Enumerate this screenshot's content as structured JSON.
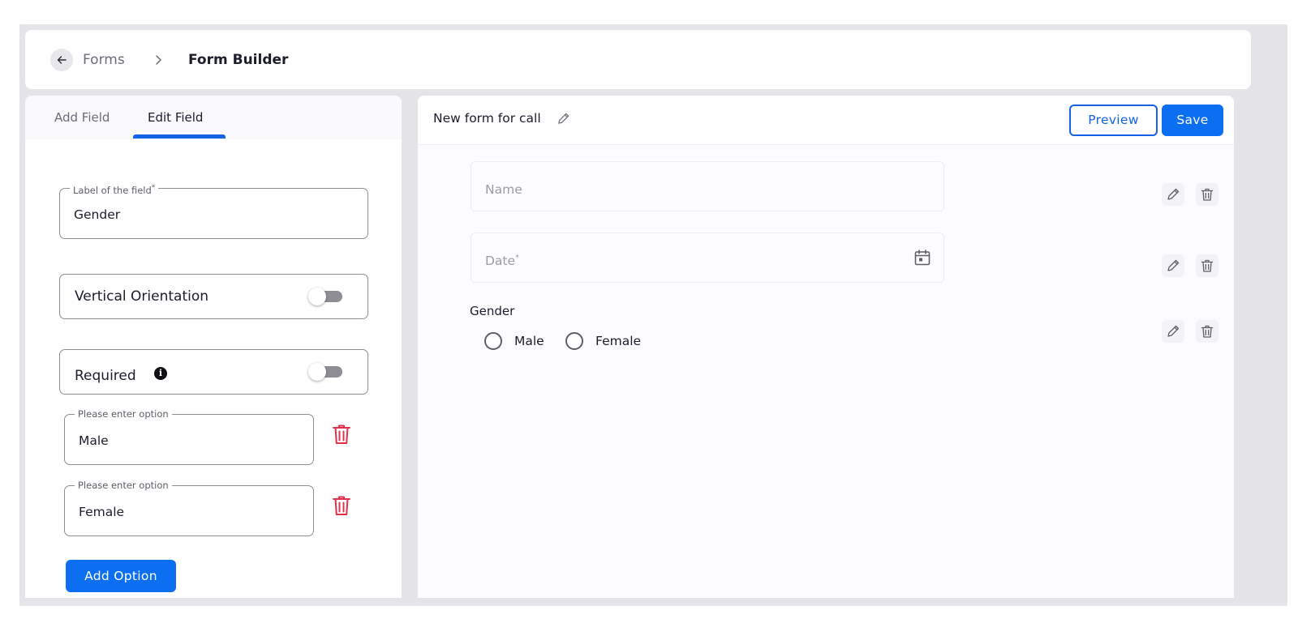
{
  "header": {
    "breadcrumb_parent": "Forms",
    "breadcrumb_current": "Form Builder"
  },
  "left_panel": {
    "tabs": [
      {
        "label": "Add Field",
        "active": false
      },
      {
        "label": "Edit Field",
        "active": true
      }
    ],
    "label_field": {
      "legend": "Label of the field",
      "required_mark": "*",
      "value": "Gender"
    },
    "vertical_orientation": {
      "label": "Vertical Orientation",
      "on": false
    },
    "required": {
      "label": "Required",
      "on": false,
      "info_icon": "info-icon"
    },
    "options": [
      {
        "legend": "Please enter option",
        "value": "Male"
      },
      {
        "legend": "Please enter option",
        "value": "Female"
      }
    ],
    "add_option_label": "Add Option"
  },
  "right_panel": {
    "form_title": "New form for call",
    "preview_label": "Preview",
    "save_label": "Save",
    "fields": [
      {
        "placeholder": "Name",
        "required_mark": ""
      },
      {
        "placeholder": "Date",
        "required_mark": "*"
      }
    ],
    "gender_field": {
      "label": "Gender",
      "options": [
        "Male",
        "Female"
      ]
    }
  },
  "colors": {
    "accent": "#0c6ff2",
    "danger": "#e0314b",
    "frame": "#e5e4e8"
  }
}
